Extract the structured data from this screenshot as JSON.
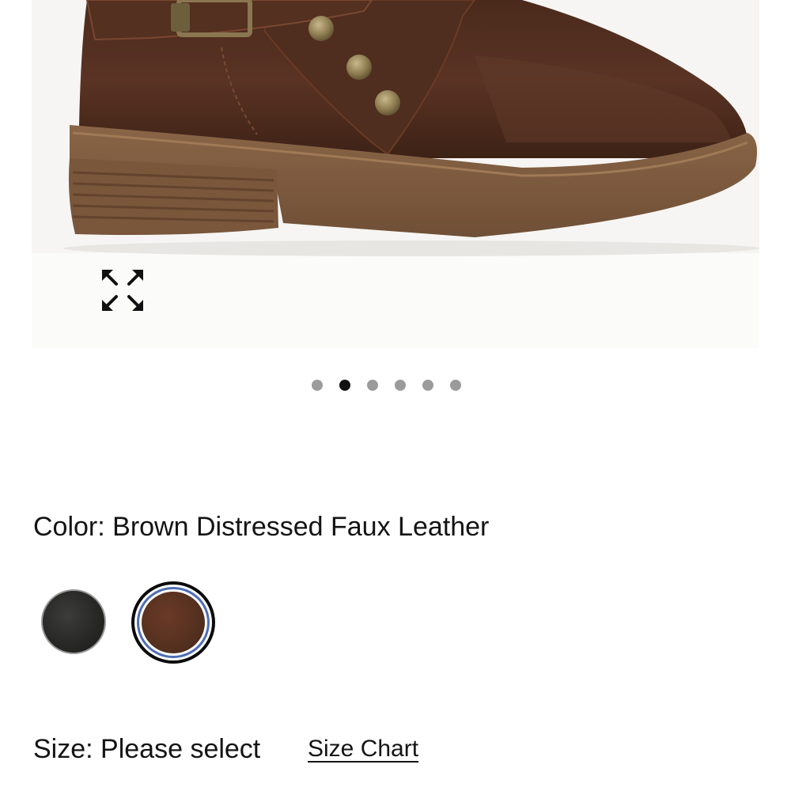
{
  "product_image": {
    "alt": "Brown distressed faux leather ankle boot with buckle strap and studs",
    "expand_icon": "expand-arrows-icon"
  },
  "carousel": {
    "total": 6,
    "active_index": 1
  },
  "color": {
    "label": "Color: Brown Distressed Faux Leather",
    "swatches": [
      {
        "name": "black",
        "hex": "#262724",
        "selected": false
      },
      {
        "name": "brown",
        "hex": "#55301f",
        "selected": true
      }
    ],
    "selected_ring_color": "#4d6db8"
  },
  "size": {
    "label": "Size: Please select",
    "chart_link": "Size Chart"
  }
}
